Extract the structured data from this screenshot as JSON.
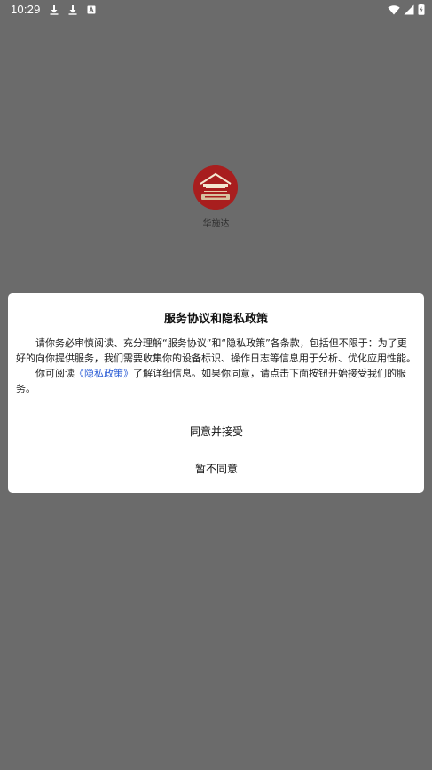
{
  "status_bar": {
    "time": "10:29",
    "left_icons": [
      "download-icon",
      "download-icon",
      "notification-icon"
    ],
    "right_icons": [
      "wifi-icon",
      "signal-icon",
      "battery-icon"
    ]
  },
  "app": {
    "name": "华施达",
    "logo_icon": "app-logo-icon",
    "logo_color": "#a81e1e"
  },
  "dialog": {
    "title": "服务协议和隐私政策",
    "paragraph1": "请你务必审慎阅读、充分理解“服务协议”和“隐私政策”各条款，包括但不限于：为了更好的向你提供服务，我们需要收集你的设备标识、操作日志等信息用于分析、优化应用性能。",
    "paragraph2_prefix": "你可阅读",
    "paragraph2_link": "《隐私政策》",
    "paragraph2_suffix": "了解详细信息。如果你同意，请点击下面按钮开始接受我们的服务。",
    "agree_label": "同意并接受",
    "decline_label": "暂不同意",
    "link_color": "#2e5fd6"
  }
}
